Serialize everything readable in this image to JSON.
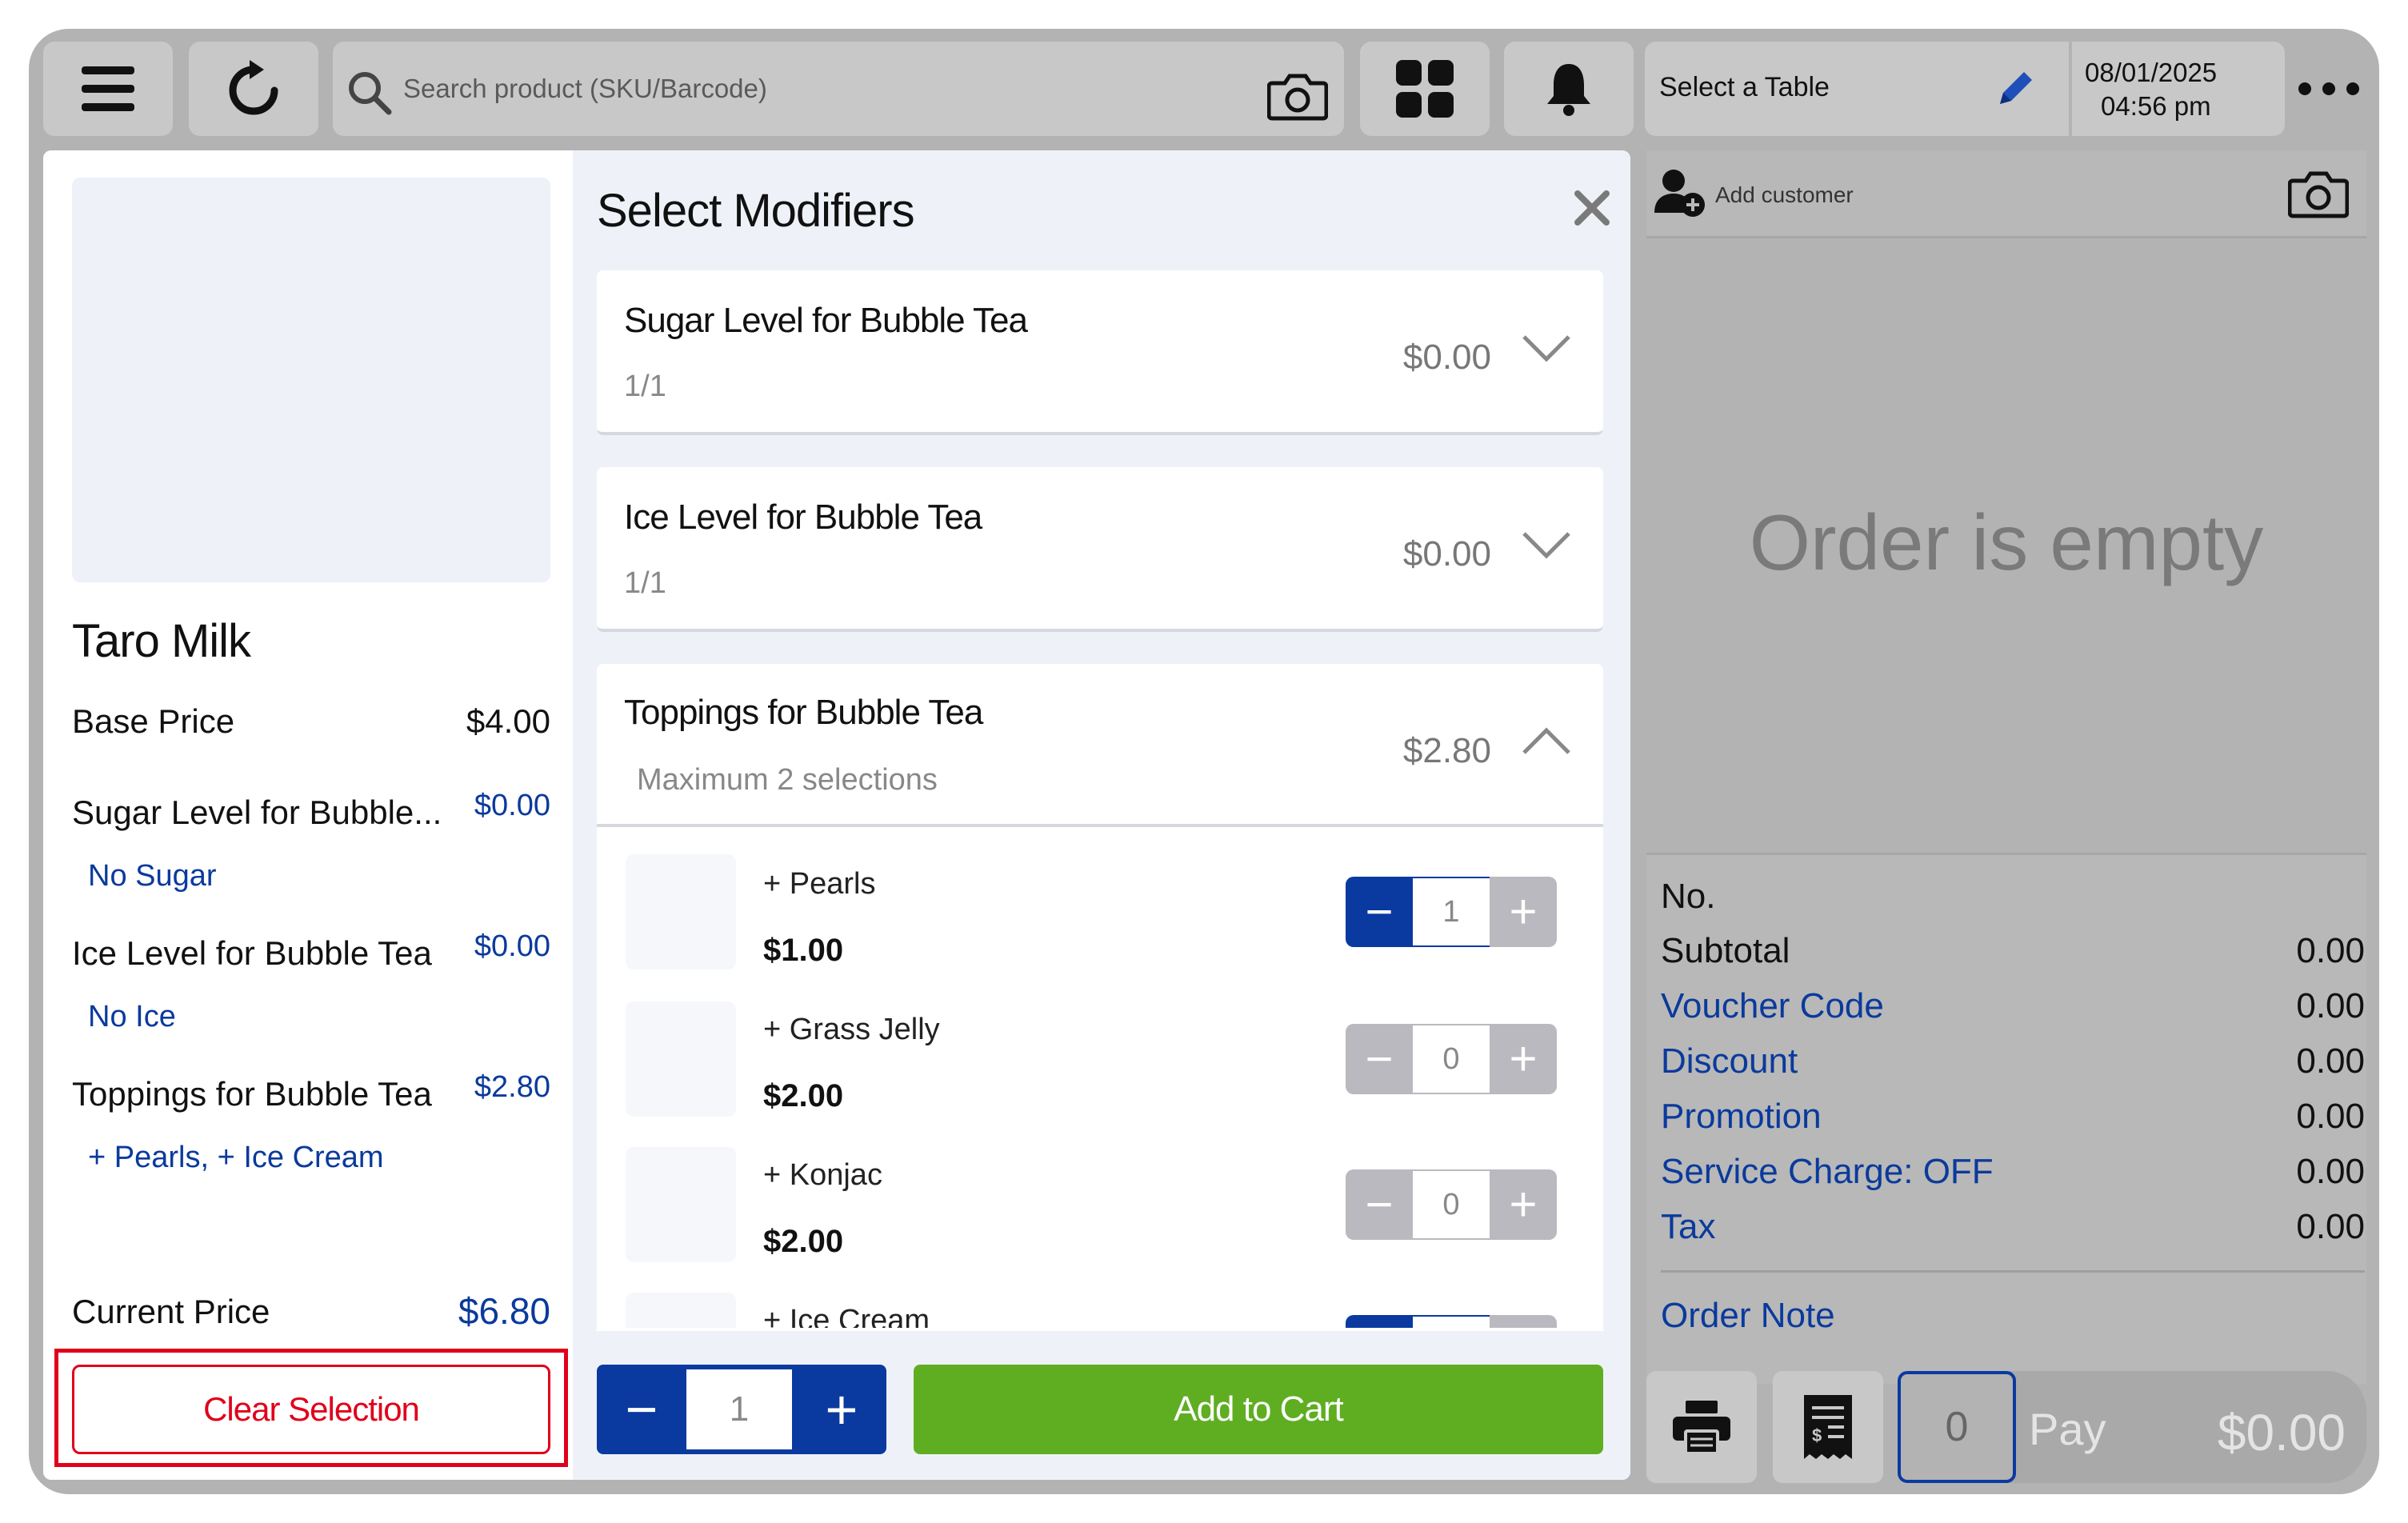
{
  "topbar": {
    "search_placeholder": "Search product (SKU/Barcode)",
    "table_label": "Select a Table",
    "date": "08/01/2025",
    "time": "04:56 pm"
  },
  "product": {
    "name": "Taro Milk",
    "base_price_label": "Base Price",
    "base_price": "$4.00",
    "lines": [
      {
        "label": "Sugar Level for Bubble...",
        "price": "$0.00",
        "selection": "No Sugar"
      },
      {
        "label": "Ice Level for Bubble Tea",
        "price": "$0.00",
        "selection": "No Ice"
      },
      {
        "label": "Toppings for Bubble Tea",
        "price": "$2.80",
        "selection": "+ Pearls, + Ice Cream"
      }
    ],
    "current_price_label": "Current Price",
    "current_price": "$6.80",
    "clear_label": "Clear Selection"
  },
  "modal": {
    "title": "Select Modifiers",
    "groups": [
      {
        "title": "Sugar Level for Bubble Tea",
        "sub": "1/1",
        "price": "$0.00"
      },
      {
        "title": "Ice Level for Bubble Tea",
        "sub": "1/1",
        "price": "$0.00"
      },
      {
        "title": "Toppings for Bubble Tea",
        "sub": "Maximum 2 selections",
        "price": "$2.80"
      }
    ],
    "toppings": [
      {
        "name": "+ Pearls",
        "price": "$1.00",
        "qty": "1"
      },
      {
        "name": "+ Grass Jelly",
        "price": "$2.00",
        "qty": "0"
      },
      {
        "name": "+ Konjac",
        "price": "$2.00",
        "qty": "0"
      },
      {
        "name": "+ Ice Cream",
        "price": "",
        "qty": ""
      }
    ],
    "quantity": "1",
    "add_to_cart": "Add to Cart"
  },
  "order": {
    "add_customer": "Add customer",
    "empty_text": "Order is empty",
    "no_label": "No.",
    "summary": [
      {
        "label": "Subtotal",
        "value": "0.00"
      },
      {
        "label": "Voucher Code",
        "value": "0.00"
      },
      {
        "label": "Discount",
        "value": "0.00"
      },
      {
        "label": "Promotion",
        "value": "0.00"
      },
      {
        "label": "Service Charge: OFF",
        "value": "0.00"
      },
      {
        "label": "Tax",
        "value": "0.00"
      }
    ],
    "order_note": "Order Note",
    "count": "0",
    "pay_label": "Pay",
    "pay_amount": "$0.00"
  },
  "colors": {
    "primary_blue": "#0a3aa0",
    "green": "#5fae22",
    "red": "#e0001b"
  }
}
